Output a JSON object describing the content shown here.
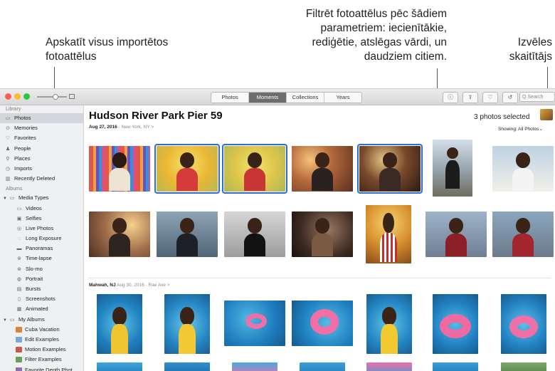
{
  "callouts": {
    "imports": [
      "Apskatīt visus importētos",
      "fotoattēlus"
    ],
    "filter": [
      "Filtrēt fotoattēlus pēc šādiem",
      "parametriem: iecienītākie,",
      "rediģētie, atslēgas vārdi, un",
      "daudziem citiem."
    ],
    "picker": [
      "Izvēles",
      "skaitītājs"
    ]
  },
  "toolbar": {
    "tabs": [
      "Photos",
      "Moments",
      "Collections",
      "Years"
    ],
    "active_tab": "Moments",
    "search_placeholder": "Q Search"
  },
  "sidebar": {
    "library_header": "Library",
    "library": [
      {
        "label": "Photos",
        "icon": "photos-icon",
        "glyph": "▭",
        "selected": true
      },
      {
        "label": "Memories",
        "icon": "memories-icon",
        "glyph": "⊙"
      },
      {
        "label": "Favorites",
        "icon": "heart-icon",
        "glyph": "♡"
      },
      {
        "label": "People",
        "icon": "person-icon",
        "glyph": "♟"
      },
      {
        "label": "Places",
        "icon": "pin-icon",
        "glyph": "⚲"
      },
      {
        "label": "Imports",
        "icon": "clock-icon",
        "glyph": "◷"
      },
      {
        "label": "Recently Deleted",
        "icon": "trash-icon",
        "glyph": "▥"
      }
    ],
    "albums_header": "Albums",
    "media_types_label": "Media Types",
    "media_types": [
      {
        "label": "Videos",
        "icon": "video-icon",
        "glyph": "▭"
      },
      {
        "label": "Selfies",
        "icon": "selfie-icon",
        "glyph": "▣"
      },
      {
        "label": "Live Photos",
        "icon": "live-photo-icon",
        "glyph": "◎"
      },
      {
        "label": "Long Exposure",
        "icon": "long-exposure-icon",
        "glyph": "◌"
      },
      {
        "label": "Panoramas",
        "icon": "panorama-icon",
        "glyph": "▬"
      },
      {
        "label": "Time-lapse",
        "icon": "timelapse-icon",
        "glyph": "⊚"
      },
      {
        "label": "Slo-mo",
        "icon": "slomo-icon",
        "glyph": "⊛"
      },
      {
        "label": "Portrait",
        "icon": "portrait-icon",
        "glyph": "◍"
      },
      {
        "label": "Bursts",
        "icon": "bursts-icon",
        "glyph": "▤"
      },
      {
        "label": "Screenshots",
        "icon": "screenshot-icon",
        "glyph": "▯"
      },
      {
        "label": "Animated",
        "icon": "animated-icon",
        "glyph": "▦"
      }
    ],
    "my_albums_label": "My Albums",
    "my_albums": [
      {
        "label": "Cuba Vacation"
      },
      {
        "label": "Edit Examples"
      },
      {
        "label": "Motion Examples"
      },
      {
        "label": "Filter Examples"
      },
      {
        "label": "Favorite Depth Phot"
      }
    ]
  },
  "moment1": {
    "title": "Hudson River Park Pier 59",
    "date": "Aug 27, 2016",
    "sep": " · ",
    "location": "New York, NY",
    "chevron": ">",
    "selected_count": "3 photos selected",
    "showing": "Showing: All Photos",
    "showing_chevron": "⌄"
  },
  "moment2": {
    "place": "Mahwah, NJ",
    "date": "Aug 30, 2016",
    "sep": " · ",
    "location": "Rae Ave",
    "chevron": ">"
  },
  "colors": {
    "selection_outline": "#2e6bd9",
    "sidebar_bg": "#eef0f2",
    "active_tab_bg": "#6d6d6d"
  }
}
